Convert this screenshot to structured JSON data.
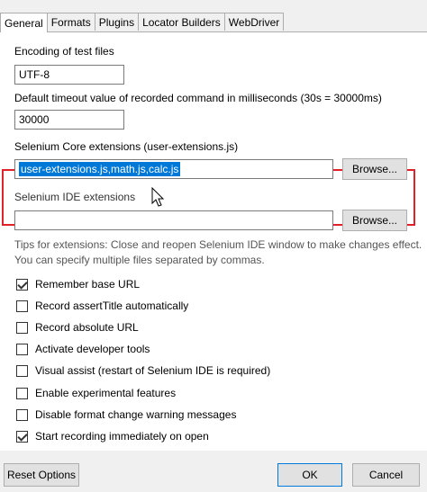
{
  "tabs": [
    "General",
    "Formats",
    "Plugins",
    "Locator Builders",
    "WebDriver"
  ],
  "encoding": {
    "label": "Encoding of test files",
    "value": "UTF-8"
  },
  "timeout": {
    "label": "Default timeout value of recorded command in milliseconds (30s = 30000ms)",
    "value": "30000"
  },
  "core_ext": {
    "label": "Selenium Core extensions (user-extensions.js)",
    "value": "user-extensions.js,math.js,calc.js",
    "browse": "Browse..."
  },
  "ide_ext": {
    "label": "Selenium IDE extensions",
    "value": "",
    "browse": "Browse..."
  },
  "tips": [
    "Tips for extensions: Close and reopen Selenium IDE window to make changes effect.",
    "You can specify multiple files separated by commas."
  ],
  "options": [
    {
      "label": "Remember base URL",
      "checked": true
    },
    {
      "label": "Record assertTitle automatically",
      "checked": false
    },
    {
      "label": "Record absolute URL",
      "checked": false
    },
    {
      "label": "Activate developer tools",
      "checked": false
    },
    {
      "label": "Visual assist (restart of Selenium IDE is required)",
      "checked": false
    },
    {
      "label": "Enable experimental features",
      "checked": false
    },
    {
      "label": "Disable format change warning messages",
      "checked": false
    },
    {
      "label": "Start recording immediately on open",
      "checked": true
    }
  ],
  "footer": {
    "reset": "Reset Options",
    "ok": "OK",
    "cancel": "Cancel"
  },
  "colors": {
    "highlight": "#e0212a",
    "selection": "#0078d7"
  }
}
